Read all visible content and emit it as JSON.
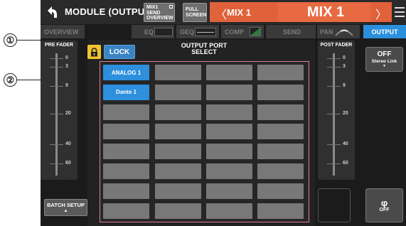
{
  "callouts": [
    "①",
    "②"
  ],
  "titlebar": {
    "back_icon": "back-arrow-icon",
    "title": "MODULE (OUTPUT)",
    "sends_on_fader": [
      "MIX1",
      "SEND",
      "OVERVIEW"
    ],
    "full_screen": [
      "FULL",
      "SCREEN"
    ],
    "channel_prev": "〈",
    "channel_name_small": "MIX 1",
    "channel_name_big": "MIX 1",
    "channel_next": "〉",
    "menu_icon": "menu-icon",
    "channel_color": "#e0613a"
  },
  "tabs": {
    "overview": "OVERVIEW",
    "eq": "EQ",
    "geq": "GEQ",
    "comp": "COMP",
    "send": "SEND",
    "pan": "PAN",
    "output": "OUTPUT"
  },
  "pre_fader": {
    "label": "PRE FADER",
    "scale": [
      "0",
      "3",
      "9",
      "20",
      "40",
      "60"
    ]
  },
  "post_fader": {
    "label": "POST FADER",
    "scale": [
      "0",
      "3",
      "9",
      "20",
      "40",
      "60"
    ]
  },
  "lock": {
    "icon": "lock-icon",
    "label": "LOCK"
  },
  "output_port": {
    "title_line1": "OUTPUT PORT",
    "title_line2": "SELECT"
  },
  "port_grid": {
    "rows": [
      [
        "ANALOG 1",
        "",
        "",
        ""
      ],
      [
        "Dante 1",
        "",
        "",
        ""
      ],
      [
        "",
        "",
        "",
        ""
      ],
      [
        "",
        "",
        "",
        ""
      ],
      [
        "",
        "",
        "",
        ""
      ],
      [
        "",
        "",
        "",
        ""
      ],
      [
        "",
        "",
        "",
        ""
      ],
      [
        "",
        "",
        "",
        ""
      ]
    ],
    "selected": [
      "ANALOG 1",
      "Dante 1"
    ],
    "accent": "#2d8fdd"
  },
  "stereo_link": {
    "state": "OFF",
    "label": "Stereo Link",
    "arrow": "▼"
  },
  "phase": {
    "symbol": "φ",
    "state": "OFF"
  },
  "batch_setup": {
    "label": "BATCH SETUP",
    "arrow": "▲"
  }
}
